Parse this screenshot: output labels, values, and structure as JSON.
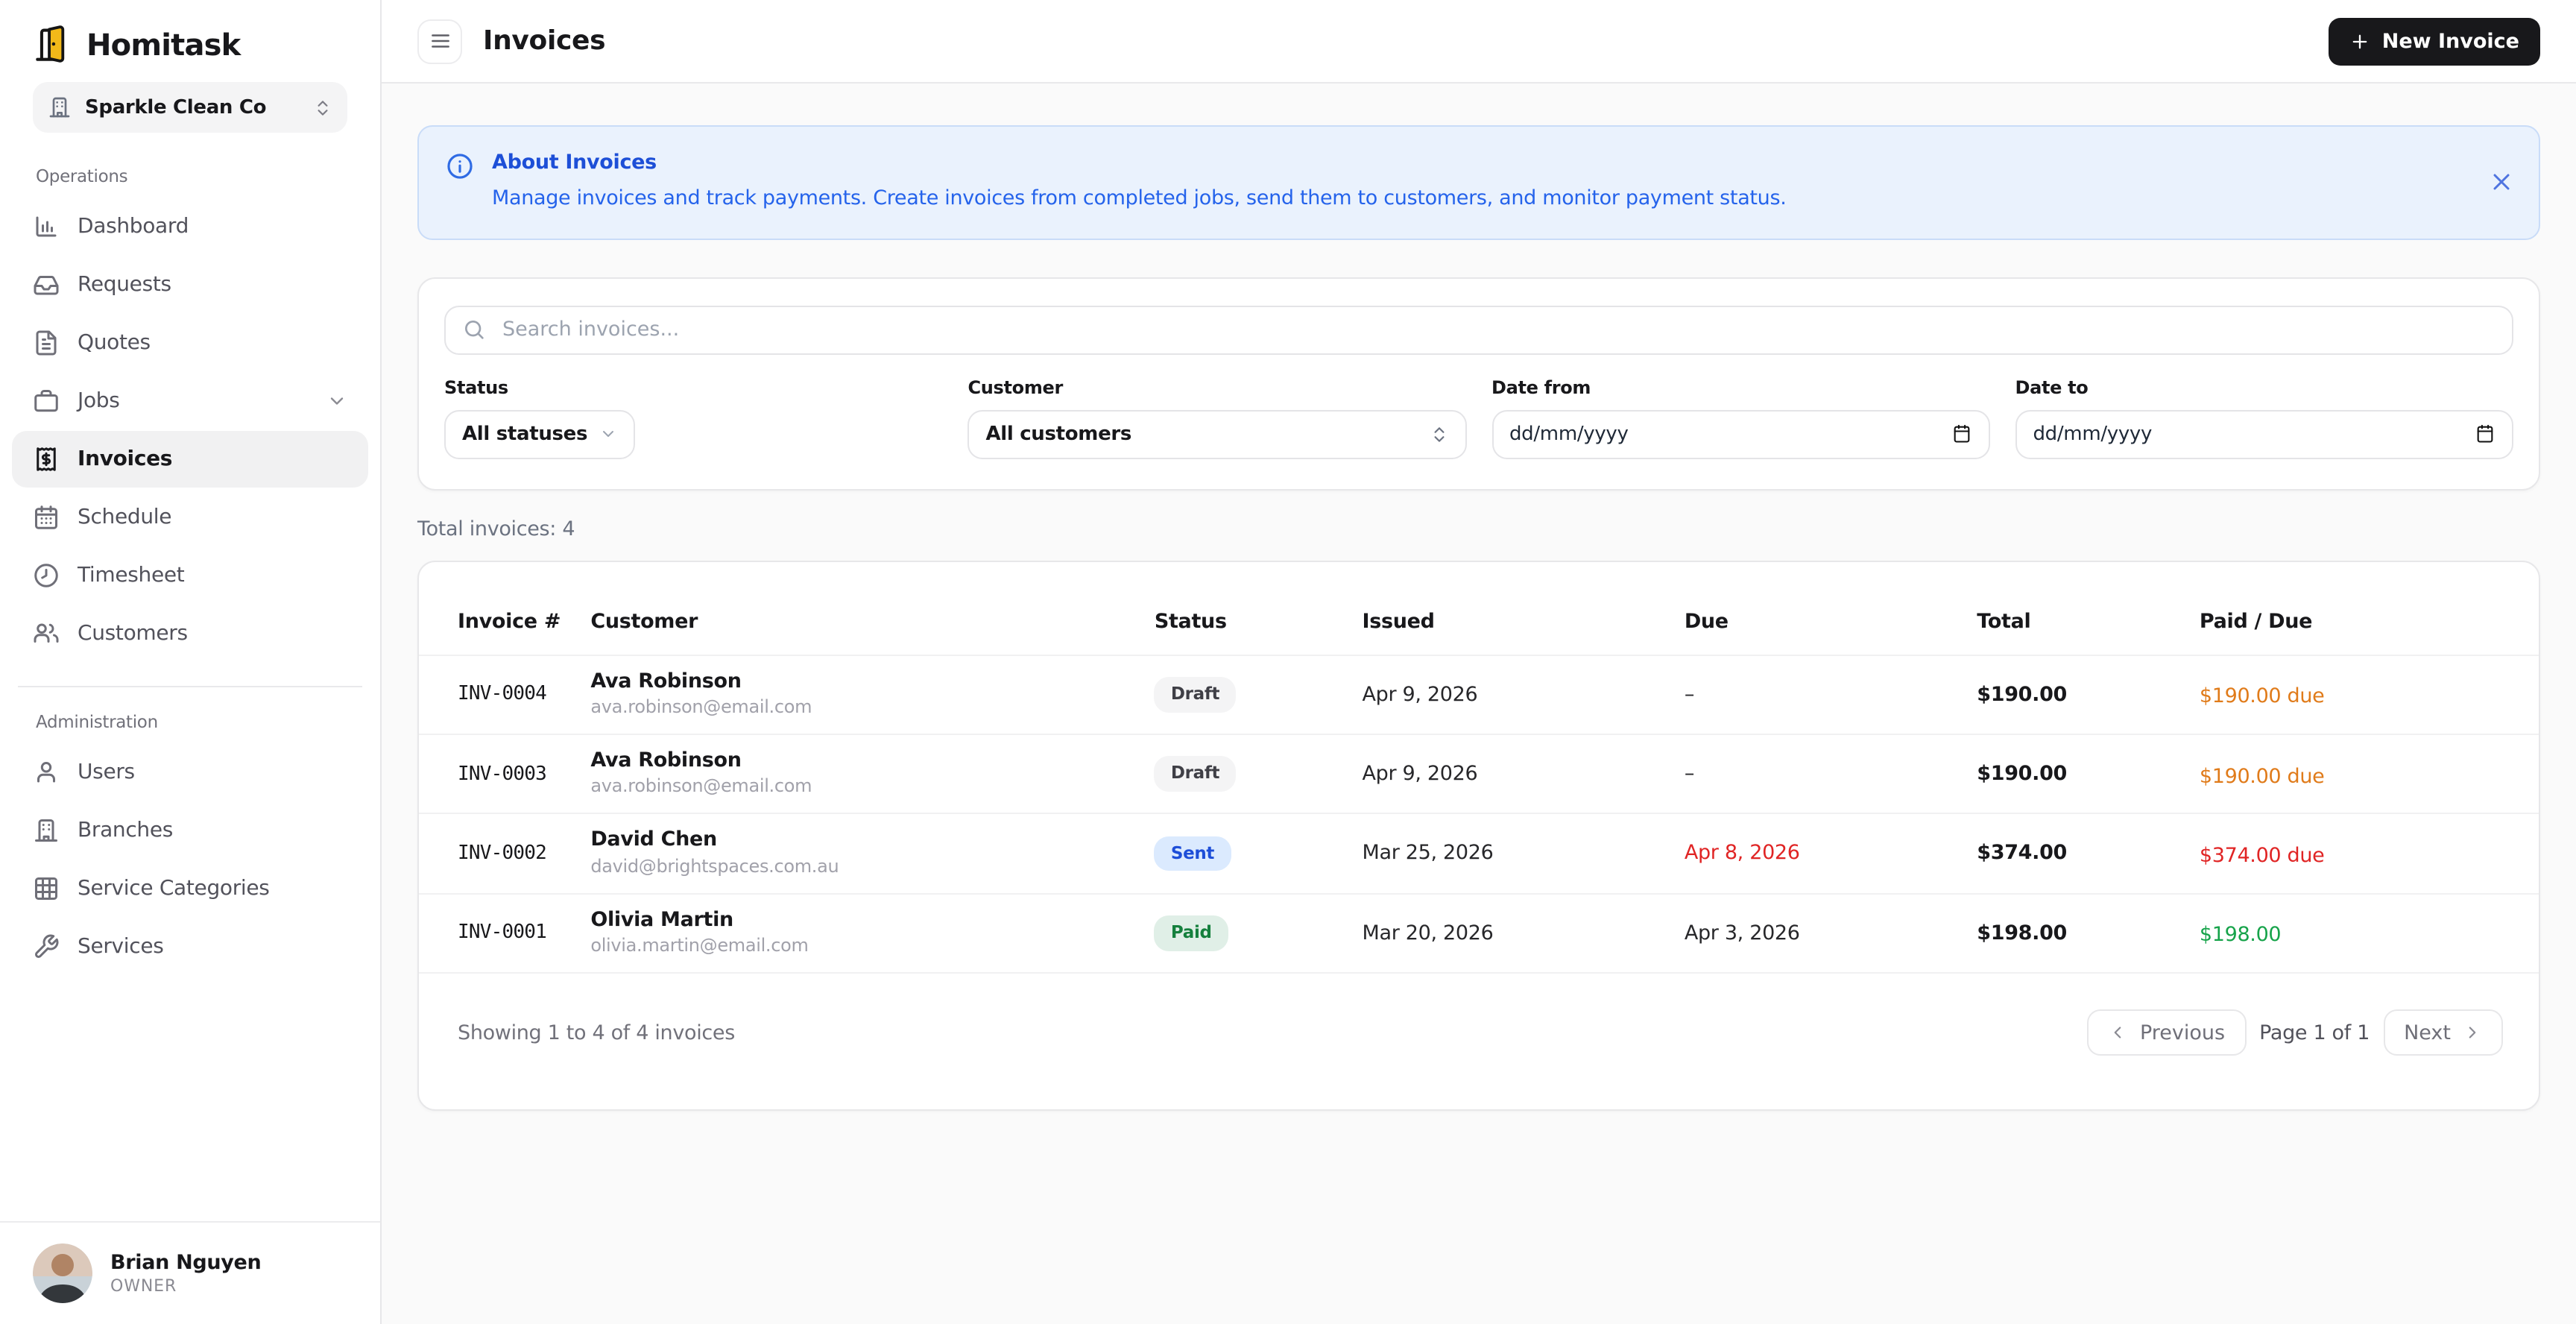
{
  "brand": {
    "name": "Homitask",
    "logo_icon": "door-logo-icon"
  },
  "company_selector": {
    "name": "Sparkle Clean Co",
    "icon": "building-icon",
    "chevron_icon": "chevrons-up-down-icon"
  },
  "sidebar": {
    "sections": [
      {
        "label": "Operations",
        "items": [
          {
            "label": "Dashboard",
            "icon": "dashboard-chart-icon"
          },
          {
            "label": "Requests",
            "icon": "inbox-icon"
          },
          {
            "label": "Quotes",
            "icon": "quote-document-icon"
          },
          {
            "label": "Jobs",
            "icon": "briefcase-icon",
            "trailing_icon": "chevron-down-icon"
          },
          {
            "label": "Invoices",
            "icon": "invoice-receipt-icon",
            "active": true
          },
          {
            "label": "Schedule",
            "icon": "calendar-icon"
          },
          {
            "label": "Timesheet",
            "icon": "clock-icon"
          },
          {
            "label": "Customers",
            "icon": "users-icon"
          }
        ]
      },
      {
        "label": "Administration",
        "items": [
          {
            "label": "Users",
            "icon": "user-icon"
          },
          {
            "label": "Branches",
            "icon": "building-icon"
          },
          {
            "label": "Service Categories",
            "icon": "grid-icon"
          },
          {
            "label": "Services",
            "icon": "wrench-icon"
          }
        ]
      }
    ]
  },
  "user": {
    "name": "Brian Nguyen",
    "role": "OWNER"
  },
  "header": {
    "title": "Invoices",
    "new_invoice_label": "New Invoice"
  },
  "banner": {
    "title": "About Invoices",
    "description": "Manage invoices and track payments. Create invoices from completed jobs, send them to customers, and monitor payment status."
  },
  "filters": {
    "search_placeholder": "Search invoices...",
    "status": {
      "label": "Status",
      "value": "All statuses"
    },
    "customer": {
      "label": "Customer",
      "value": "All customers"
    },
    "date_from": {
      "label": "Date from",
      "placeholder": "dd/mm/yyyy"
    },
    "date_to": {
      "label": "Date to",
      "placeholder": "dd/mm/yyyy"
    }
  },
  "summary": {
    "total_label": "Total invoices: 4"
  },
  "table": {
    "columns": [
      "Invoice #",
      "Customer",
      "Status",
      "Issued",
      "Due",
      "Total",
      "Paid / Due"
    ],
    "rows": [
      {
        "invoice_no": "INV-0004",
        "customer_name": "Ava Robinson",
        "customer_email": "ava.robinson@email.com",
        "status": "Draft",
        "issued": "Apr 9, 2026",
        "due": "–",
        "due_overdue": false,
        "total": "$190.00",
        "paid_due": "$190.00 due",
        "paid_due_color": "orange"
      },
      {
        "invoice_no": "INV-0003",
        "customer_name": "Ava Robinson",
        "customer_email": "ava.robinson@email.com",
        "status": "Draft",
        "issued": "Apr 9, 2026",
        "due": "–",
        "due_overdue": false,
        "total": "$190.00",
        "paid_due": "$190.00 due",
        "paid_due_color": "orange"
      },
      {
        "invoice_no": "INV-0002",
        "customer_name": "David Chen",
        "customer_email": "david@brightspaces.com.au",
        "status": "Sent",
        "issued": "Mar 25, 2026",
        "due": "Apr 8, 2026",
        "due_overdue": true,
        "total": "$374.00",
        "paid_due": "$374.00 due",
        "paid_due_color": "red"
      },
      {
        "invoice_no": "INV-0001",
        "customer_name": "Olivia Martin",
        "customer_email": "olivia.martin@email.com",
        "status": "Paid",
        "issued": "Mar 20, 2026",
        "due": "Apr 3, 2026",
        "due_overdue": false,
        "total": "$198.00",
        "paid_due": "$198.00",
        "paid_due_color": "green"
      }
    ]
  },
  "pagination": {
    "showing": "Showing 1 to 4 of 4 invoices",
    "previous_label": "Previous",
    "page_label": "Page 1 of 1",
    "next_label": "Next"
  },
  "colors": {
    "brand_yellow": "#f2b919",
    "accent_dark": "#18181b",
    "banner_bg": "#eaf2fd",
    "banner_text": "#2563eb",
    "due_orange": "#e07b1a",
    "overdue_red": "#e02424",
    "paid_green": "#16a34a",
    "badge_draft_bg": "#f4f4f5",
    "badge_sent_bg": "#dbeafe",
    "badge_sent_text": "#1d4ed8",
    "badge_paid_bg": "#e0efe7",
    "badge_paid_text": "#15803d"
  }
}
